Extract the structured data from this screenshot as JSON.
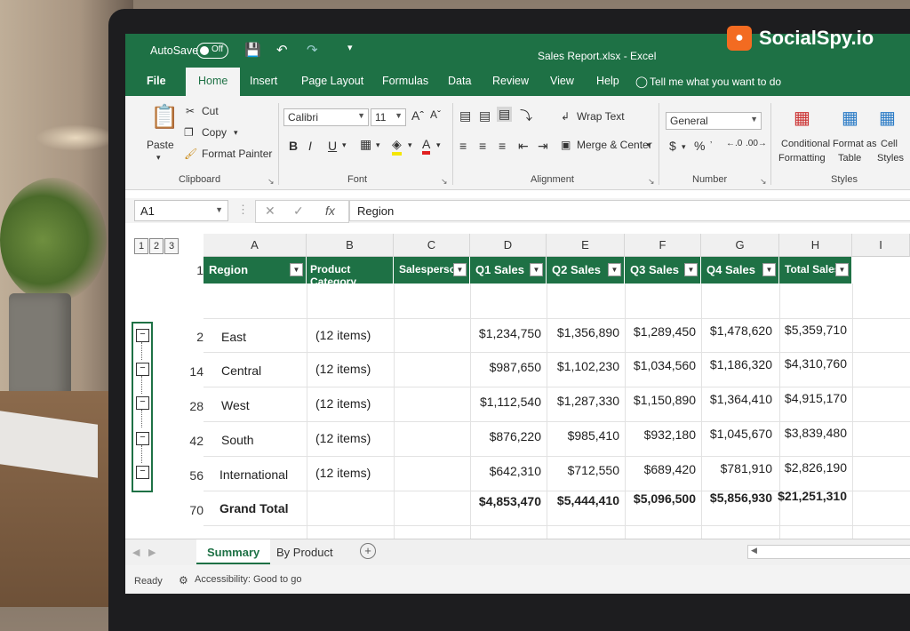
{
  "app": {
    "autosave_label": "AutoSave",
    "autosave_state": "Off",
    "document_title": "Sales Report.xlsx  -  Excel"
  },
  "watermark": {
    "logo_text": "SocialSpy.io"
  },
  "menu": {
    "tabs": [
      "File",
      "Home",
      "Insert",
      "Page Layout",
      "Formulas",
      "Data",
      "Review",
      "View",
      "Help"
    ],
    "active_tab": "Home",
    "tell_me": "Tell me what you want to do"
  },
  "ribbon": {
    "clipboard": {
      "paste": "Paste",
      "cut": "Cut",
      "copy": "Copy",
      "format_painter": "Format Painter",
      "label": "Clipboard"
    },
    "font": {
      "family": "Calibri",
      "size": "11",
      "label": "Font",
      "bold": "B",
      "italic": "I",
      "underline": "U"
    },
    "alignment": {
      "wrap_text": "Wrap Text",
      "merge_center": "Merge & Center",
      "label": "Alignment"
    },
    "number": {
      "format": "General",
      "currency": "$",
      "percent": "%",
      "label": "Number"
    },
    "styles": {
      "conditional": "Conditional",
      "formatting": "Formatting",
      "format_as": "Format as",
      "table": "Table",
      "cell": "Cell",
      "cell_styles": "Styles",
      "label": "Styles"
    }
  },
  "formula_bar": {
    "name_box": "A1",
    "fx": "fx",
    "content": "Region"
  },
  "outline_levels": [
    "1",
    "2",
    "3"
  ],
  "columns": [
    "A",
    "B",
    "C",
    "D",
    "E",
    "F",
    "G",
    "H",
    "I"
  ],
  "table": {
    "headers": [
      "Region",
      "Product Category",
      "Salesperson",
      "Q1 Sales",
      "Q2 Sales",
      "Q3 Sales",
      "Q4 Sales",
      "Total Sales"
    ],
    "header_row_number": "1",
    "rows": [
      {
        "row_num": "2",
        "region": "East",
        "category": "(12 items)",
        "q1": "$1,234,750",
        "q2": "$1,356,890",
        "q3": "$1,289,450",
        "q4": "$1,478,620",
        "total": "$5,359,710"
      },
      {
        "row_num": "14",
        "region": "Central",
        "category": "(12 items)",
        "q1": "$987,650",
        "q2": "$1,102,230",
        "q3": "$1,034,560",
        "q4": "$1,186,320",
        "total": "$4,310,760"
      },
      {
        "row_num": "28",
        "region": "West",
        "category": "(12 items)",
        "q1": "$1,112,540",
        "q2": "$1,287,330",
        "q3": "$1,150,890",
        "q4": "$1,364,410",
        "total": "$4,915,170"
      },
      {
        "row_num": "42",
        "region": "South",
        "category": "(12 items)",
        "q1": "$876,220",
        "q2": "$985,410",
        "q3": "$932,180",
        "q4": "$1,045,670",
        "total": "$3,839,480"
      },
      {
        "row_num": "56",
        "region": "International",
        "category": "(12 items)",
        "q1": "$642,310",
        "q2": "$712,550",
        "q3": "$689,420",
        "q4": "$781,910",
        "total": "$2,826,190"
      }
    ],
    "grand_total": {
      "row_num": "70",
      "label": "Grand Total",
      "q1": "$4,853,470",
      "q2": "$5,444,410",
      "q3": "$5,096,500",
      "q4": "$5,856,930",
      "total": "$21,251,310"
    }
  },
  "sheets": {
    "tabs": [
      "Summary",
      "By Product"
    ],
    "active": "Summary",
    "add": "+"
  },
  "status": {
    "ready": "Ready",
    "accessibility": "Accessibility: Good to go"
  },
  "colors": {
    "excel_green": "#1e7145",
    "logo_orange": "#f36b21"
  }
}
